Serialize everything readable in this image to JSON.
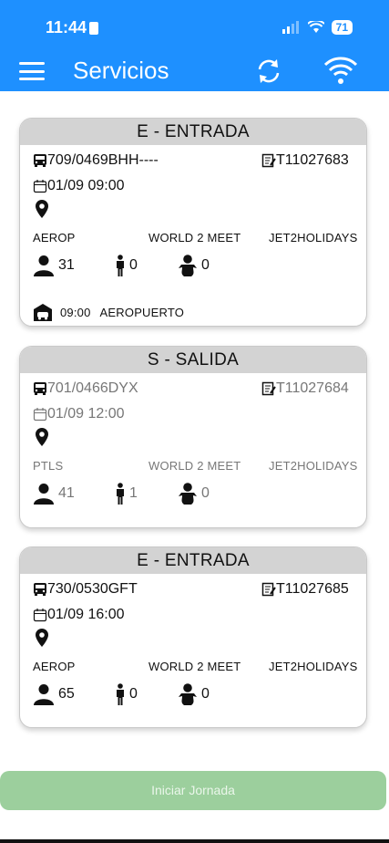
{
  "status_bar": {
    "time": "11:44",
    "battery": "71"
  },
  "app_bar": {
    "title": "Servicios"
  },
  "cards": [
    {
      "header": "E - ENTRADA",
      "vehicle": "709/0469BHH----",
      "ticket": "T11027683",
      "datetime": "01/09 09:00",
      "origin": "AEROP",
      "handler": "WORLD 2 MEET",
      "operator": "JET2HOLIDAYS",
      "adults": "31",
      "children": "0",
      "infants": "0",
      "pickup_time": "09:00",
      "pickup_place": "AEROPUERTO"
    },
    {
      "header": "S - SALIDA",
      "vehicle": "701/0466DYX",
      "ticket": "T11027684",
      "datetime": "01/09 12:00",
      "origin": "PTLS",
      "handler": "WORLD 2 MEET",
      "operator": "JET2HOLIDAYS",
      "adults": "41",
      "children": "1",
      "infants": "0"
    },
    {
      "header": "E - ENTRADA",
      "vehicle": "730/0530GFT",
      "ticket": "T11027685",
      "datetime": "01/09 16:00",
      "origin": "AEROP",
      "handler": "WORLD 2 MEET",
      "operator": "JET2HOLIDAYS",
      "adults": "65",
      "children": "0",
      "infants": "0"
    }
  ],
  "footer": {
    "start_label": "Iniciar Jornada"
  },
  "colors": {
    "primary": "#1e90ff",
    "header_bg": "#d3d3d3",
    "start_button": "#9ccf9d"
  },
  "icons": [
    "menu-icon",
    "refresh-icon",
    "wifi-icon",
    "bus-icon",
    "document-icon",
    "calendar-icon",
    "location-pin-icon",
    "adult-icon",
    "child-icon",
    "baby-icon",
    "garage-icon"
  ]
}
